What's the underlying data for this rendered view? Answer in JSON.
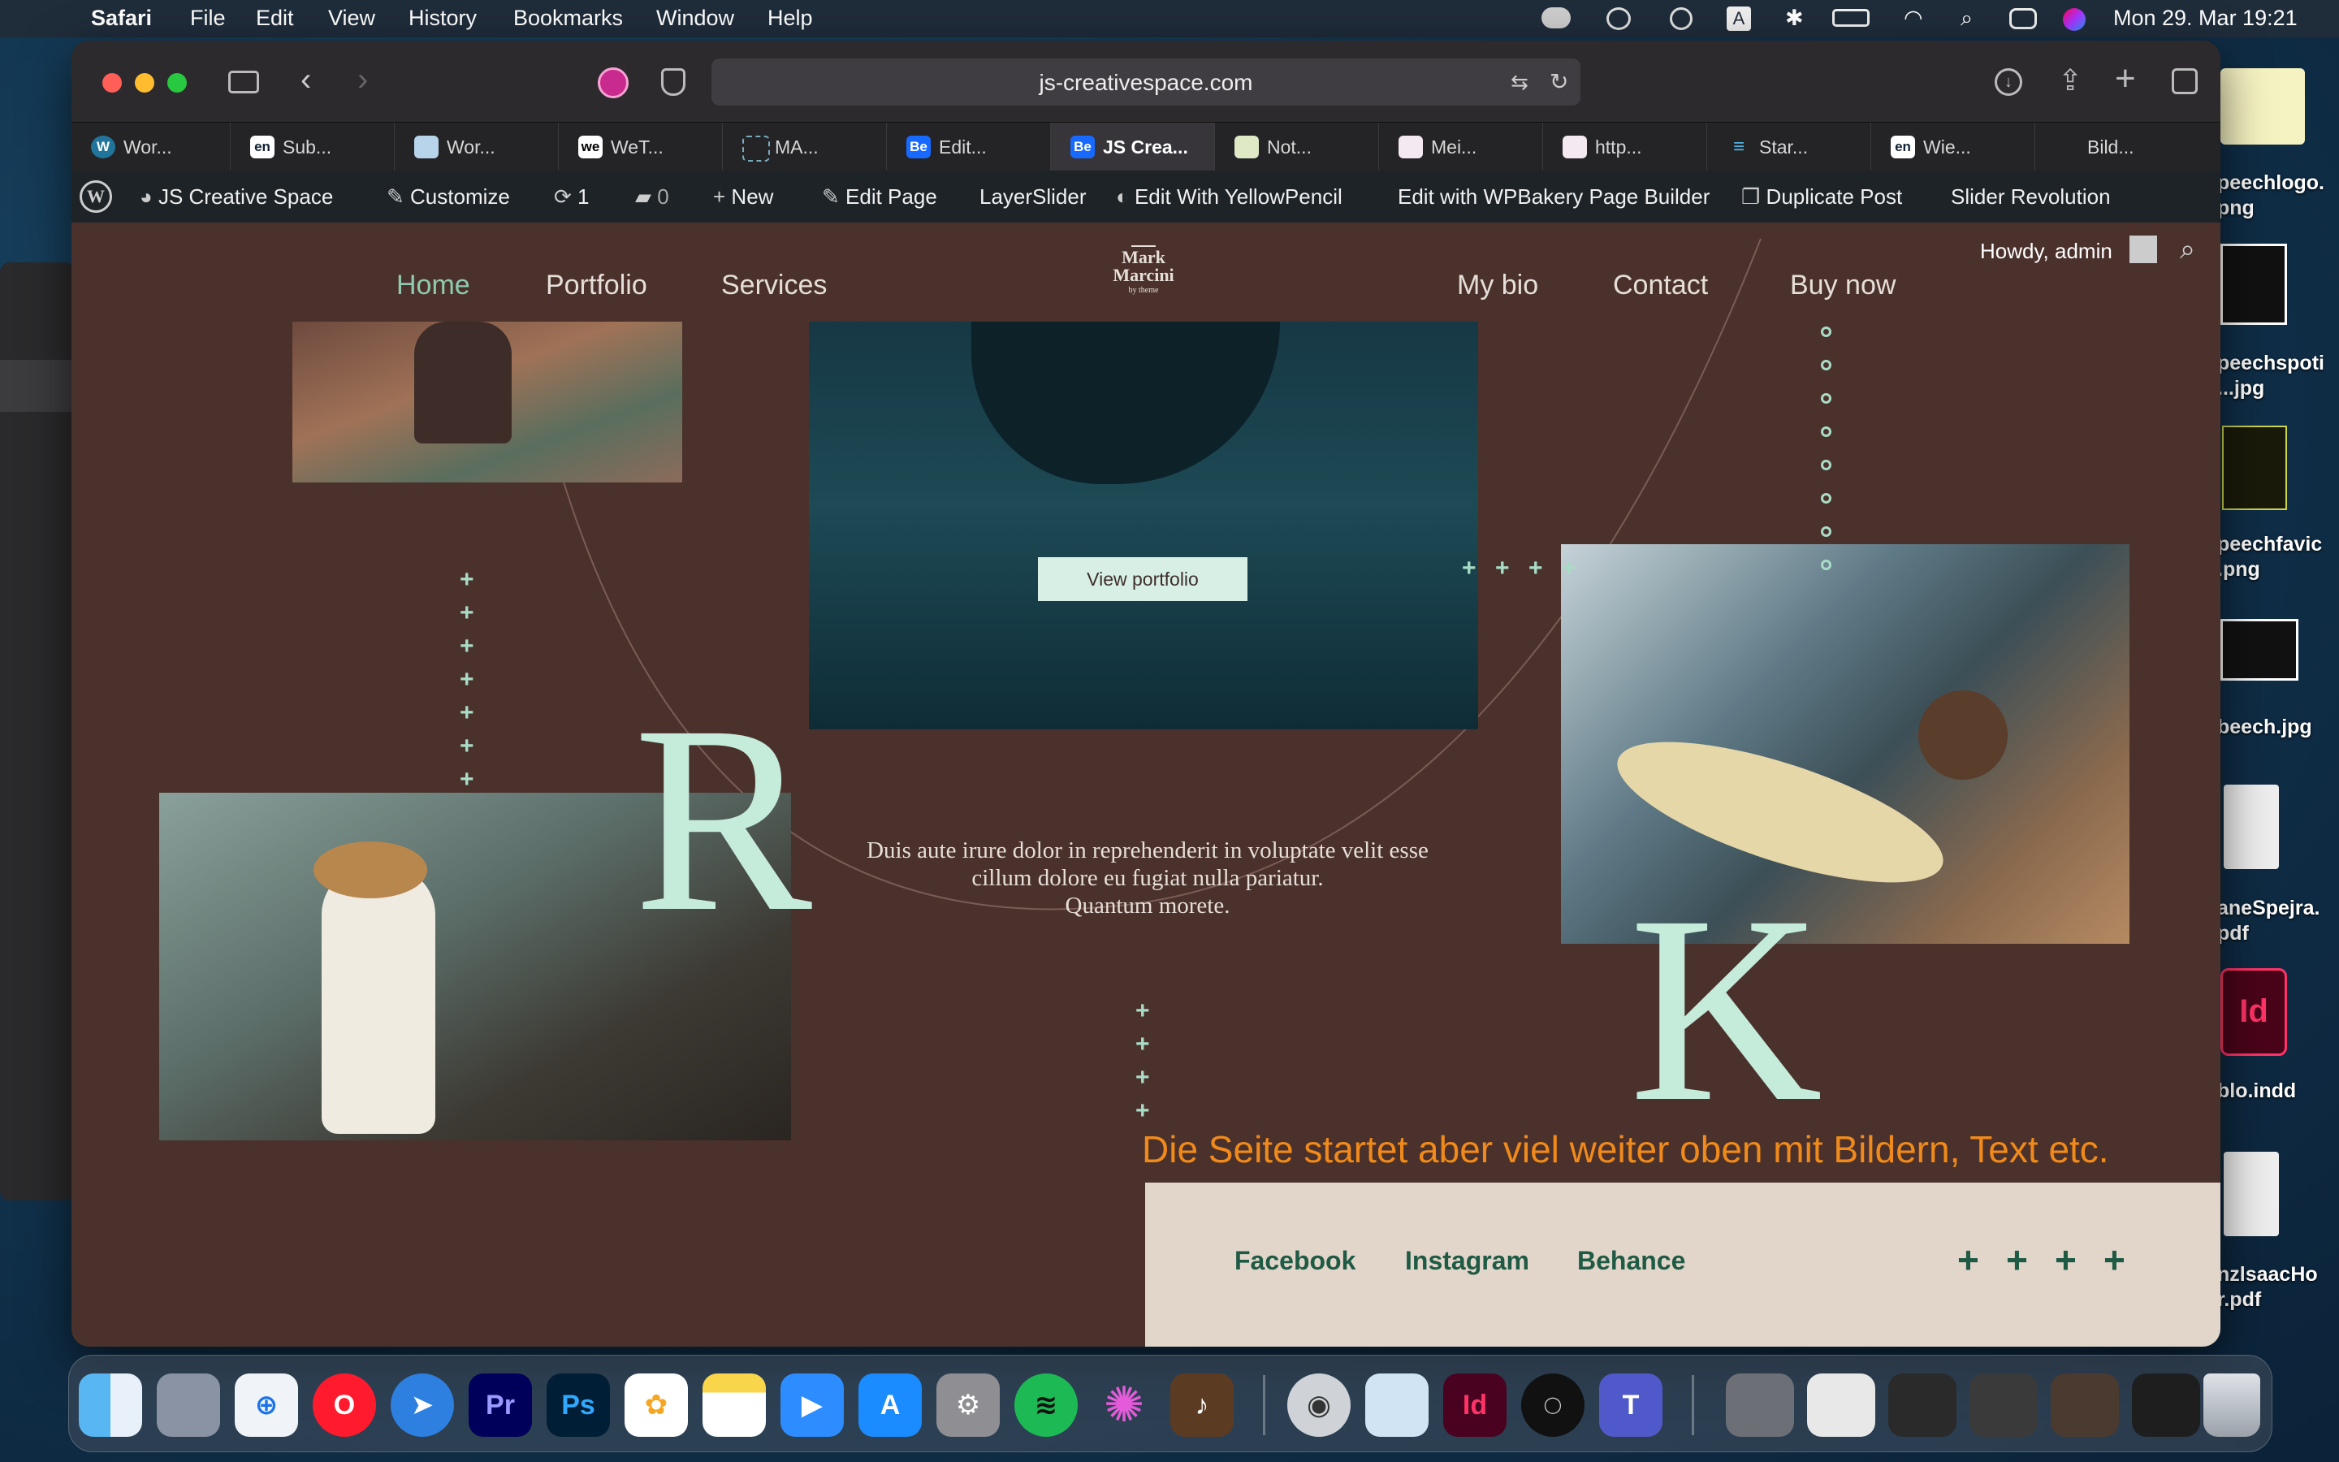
{
  "menubar": {
    "app_name": "Safari",
    "menus": [
      "File",
      "Edit",
      "View",
      "History",
      "Bookmarks",
      "Window",
      "Help"
    ],
    "clock": "Mon 29. Mar  19:21"
  },
  "browser": {
    "url": "js-creativespace.com",
    "tabs": [
      {
        "icon": "wordpress",
        "label": "Wor..."
      },
      {
        "icon": "en",
        "label": "Sub..."
      },
      {
        "icon": "doc",
        "label": "Wor..."
      },
      {
        "icon": "we",
        "label": "WeT..."
      },
      {
        "icon": "gear",
        "label": "MA..."
      },
      {
        "icon": "be",
        "label": "Edit..."
      },
      {
        "icon": "be",
        "label": "JS Crea..."
      },
      {
        "icon": "notion",
        "label": "Not..."
      },
      {
        "icon": "dots",
        "label": "Mei..."
      },
      {
        "icon": "dots",
        "label": "http..."
      },
      {
        "icon": "star",
        "label": "Star..."
      },
      {
        "icon": "en",
        "label": "Wie..."
      },
      {
        "icon": "apple",
        "label": "Bild..."
      }
    ]
  },
  "wp_admin_bar": {
    "site_name": "JS Creative Space",
    "customize": "Customize",
    "updates_count": "1",
    "comments_count": "0",
    "new": "New",
    "edit_page": "Edit Page",
    "layerslider": "LayerSlider",
    "yellowpencil": "Edit With YellowPencil",
    "wpbakery": "Edit with WPBakery Page Builder",
    "duplicate": "Duplicate Post",
    "slider_revolution": "Slider Revolution",
    "howdy": "Howdy, admin"
  },
  "site": {
    "nav_left": [
      "Home",
      "Portfolio",
      "Services"
    ],
    "nav_right": [
      "My bio",
      "Contact",
      "Buy now"
    ],
    "logo_line1": "Mark",
    "logo_line2": "Marcini",
    "logo_tag": "by theme",
    "view_portfolio": "View portfolio",
    "body_text_1": "Duis aute irure dolor in reprehenderit in voluptate velit esse",
    "body_text_2": "cillum dolore eu fugiat nulla pariatur.",
    "body_text_3": "Quantum morete.",
    "letter_r": "R",
    "letter_k": "K",
    "annotation": "Die Seite startet aber viel weiter oben mit Bildern, Text etc.",
    "footer_links": [
      "Facebook",
      "Instagram",
      "Behance"
    ],
    "colors": {
      "background": "#4b312c",
      "accent": "#a9dcc6",
      "annotation": "#f08a1a",
      "footer_bg": "#e2d6cb",
      "footer_link": "#1f5a44"
    }
  },
  "desktop_files": [
    {
      "label_1": "peechlogo.",
      "label_2": "png"
    },
    {
      "label_1": "peechspoti",
      "label_2": "...jpg"
    },
    {
      "label_1": "peechfavic",
      "label_2": ".png"
    },
    {
      "label_1": "beech.jpg",
      "label_2": ""
    },
    {
      "label_1": "aneSpejra.",
      "label_2": "pdf"
    },
    {
      "label_1": "blo.indd",
      "label_2": ""
    },
    {
      "label_1": "nzlsaacHo",
      "label_2": "r.pdf"
    }
  ],
  "dock_apps": [
    "Finder",
    "Launchpad",
    "Safari",
    "Opera",
    "Spark",
    "Premiere Pro",
    "Photoshop",
    "Photos",
    "Notes",
    "Zoom",
    "App Store",
    "System Preferences",
    "Spotify",
    "Flower",
    "GarageBand",
    "Sequel",
    "Preview",
    "InDesign",
    "Spitfire",
    "Teams"
  ]
}
